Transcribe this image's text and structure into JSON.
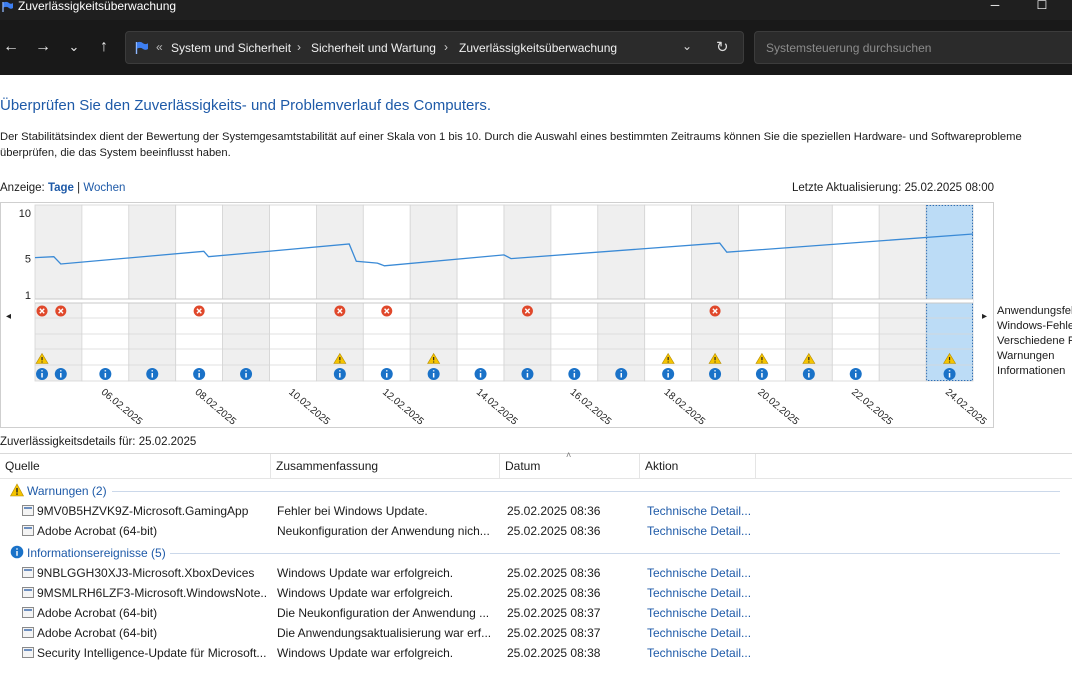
{
  "window": {
    "title": "Zuverlässigkeitsüberwachung",
    "minimize": "─",
    "maximize": "☐"
  },
  "nav": {
    "back": "←",
    "forward": "→",
    "recent": "⌄",
    "up": "↑",
    "overflow": "«",
    "breadcrumbs": [
      "System und Sicherheit",
      "Sicherheit und Wartung",
      "Zuverlässigkeitsüberwachung"
    ],
    "separator": "›",
    "dropdown": "⌄",
    "refresh": "↻",
    "search_placeholder": "Systemsteuerung durchsuchen"
  },
  "main": {
    "heading": "Überprüfen Sie den Zuverlässigkeits- und Problemverlauf des Computers.",
    "description": "Der Stabilitätsindex dient der Bewertung der Systemgesamtstabilität auf einer Skala von 1 bis 10. Durch die Auswahl eines bestimmten Zeitraums können Sie die speziellen Hardware- und Softwareprobleme überprüfen, die das System beeinflusst haben.",
    "view_label": "Anzeige:",
    "view_days": "Tage",
    "view_sep": "|",
    "view_weeks": "Wochen",
    "last_update": "Letzte Aktualisierung: 25.02.2025 08:00"
  },
  "chart_data": {
    "type": "line",
    "y_ticks": [
      "10",
      "5",
      "1"
    ],
    "ylim": [
      1,
      10
    ],
    "scroll_left": "◂",
    "scroll_right": "▸",
    "columns": 20,
    "selected_column": 19,
    "x_labels": [
      {
        "col": 1,
        "text": "06.02.2025"
      },
      {
        "col": 3,
        "text": "08.02.2025"
      },
      {
        "col": 5,
        "text": "10.02.2025"
      },
      {
        "col": 7,
        "text": "12.02.2025"
      },
      {
        "col": 9,
        "text": "14.02.2025"
      },
      {
        "col": 11,
        "text": "16.02.2025"
      },
      {
        "col": 13,
        "text": "18.02.2025"
      },
      {
        "col": 15,
        "text": "20.02.2025"
      },
      {
        "col": 17,
        "text": "22.02.2025"
      },
      {
        "col": 19,
        "text": "24.02.2025"
      }
    ],
    "stability_series": [
      [
        0,
        5.1
      ],
      [
        0.4,
        5.2
      ],
      [
        0.55,
        4.4
      ],
      [
        3.6,
        5.8
      ],
      [
        3.7,
        5.2
      ],
      [
        6.7,
        6.6
      ],
      [
        6.85,
        4.7
      ],
      [
        7.3,
        4.5
      ],
      [
        7.45,
        4.2
      ],
      [
        10.0,
        5.4
      ],
      [
        10.15,
        5.0
      ],
      [
        14.6,
        6.7
      ],
      [
        14.75,
        5.7
      ],
      [
        20,
        7.7
      ]
    ],
    "legend": [
      "Anwendungsfehler",
      "Windows-Fehler",
      "Verschiedene Fehler",
      "Warnungen",
      "Informationen"
    ],
    "critical_events": [
      0,
      0,
      3,
      6,
      7,
      10,
      14
    ],
    "critical_offsets": [
      0.15,
      0.55,
      0.5,
      0.5,
      0.5,
      0.5,
      0.5
    ],
    "warning_events": [
      0,
      6,
      8,
      13,
      14,
      15,
      16,
      19
    ],
    "info_events": [
      0,
      0,
      1,
      2,
      3,
      4,
      6,
      7,
      8,
      9,
      10,
      11,
      12,
      13,
      14,
      15,
      16,
      17,
      19
    ],
    "info_offsets": [
      0.15,
      0.55,
      0.5,
      0.5,
      0.5,
      0.5,
      0.5,
      0.5,
      0.5,
      0.5,
      0.5,
      0.5,
      0.5,
      0.5,
      0.5,
      0.5,
      0.5,
      0.5,
      0.5
    ]
  },
  "details": {
    "title": "Zuverlässigkeitsdetails für: 25.02.2025",
    "columns": [
      "Quelle",
      "Zusammenfassung",
      "Datum",
      "Aktion"
    ],
    "sort_caret": "˄",
    "groups": [
      {
        "label": "Warnungen (2)",
        "icon": "warning-icon",
        "rows": [
          {
            "source": "9MV0B5HZVK9Z-Microsoft.GamingApp",
            "summary": "Fehler bei Windows Update.",
            "date": "25.02.2025 08:36",
            "action": "Technische Detail..."
          },
          {
            "source": "Adobe Acrobat (64-bit)",
            "summary": "Neukonfiguration der Anwendung nich...",
            "date": "25.02.2025 08:36",
            "action": "Technische Detail..."
          }
        ]
      },
      {
        "label": "Informationsereignisse (5)",
        "icon": "info-icon",
        "rows": [
          {
            "source": "9NBLGGH30XJ3-Microsoft.XboxDevices",
            "summary": "Windows Update war erfolgreich.",
            "date": "25.02.2025 08:36",
            "action": "Technische Detail..."
          },
          {
            "source": "9MSMLRH6LZF3-Microsoft.WindowsNote...",
            "summary": "Windows Update war erfolgreich.",
            "date": "25.02.2025 08:36",
            "action": "Technische Detail..."
          },
          {
            "source": "Adobe Acrobat (64-bit)",
            "summary": "Die Neukonfiguration der Anwendung ...",
            "date": "25.02.2025 08:37",
            "action": "Technische Detail..."
          },
          {
            "source": "Adobe Acrobat (64-bit)",
            "summary": "Die Anwendungsaktualisierung war erf...",
            "date": "25.02.2025 08:37",
            "action": "Technische Detail..."
          },
          {
            "source": "Security Intelligence-Update für Microsoft...",
            "summary": "Windows Update war erfolgreich.",
            "date": "25.02.2025 08:38",
            "action": "Technische Detail..."
          }
        ]
      }
    ]
  },
  "colors": {
    "accent": "#1e5aa8",
    "line": "#3a8ad6",
    "critical": "#e0482b",
    "warning": "#f5c400",
    "info": "#1a72c8",
    "selected": "#bcdcf6",
    "shaded": "#efefef"
  }
}
